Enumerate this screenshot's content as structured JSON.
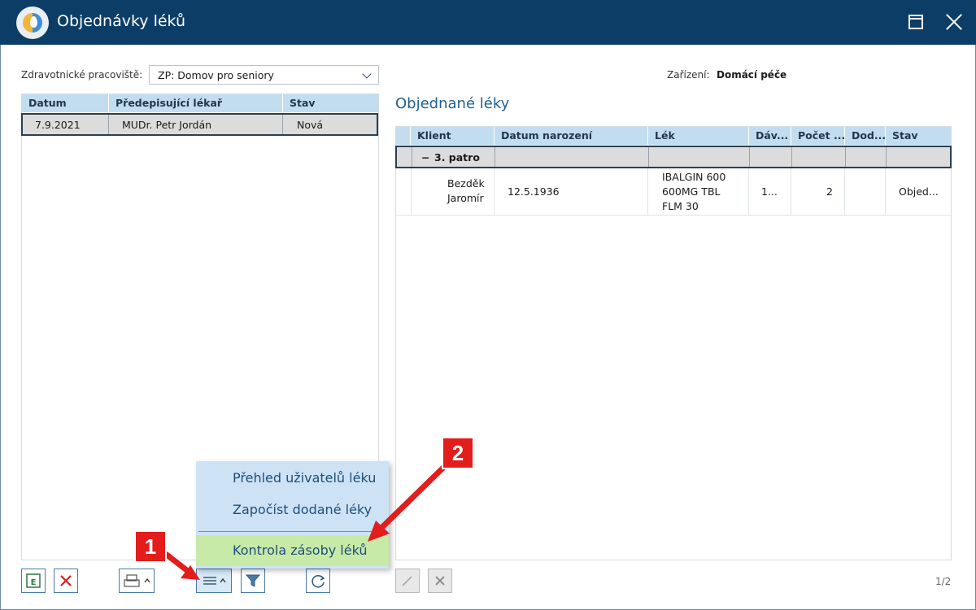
{
  "window": {
    "title": "Objednávky léků"
  },
  "filters": {
    "workplace_label": "Zdravotnické pracoviště:",
    "workplace_value": "ZP: Domov pro seniory",
    "device_label": "Zařízení:",
    "device_value": "Domácí péče"
  },
  "orders_table": {
    "columns": [
      "Datum",
      "Předepisující lékař",
      "Stav"
    ],
    "rows": [
      {
        "date": "7.9.2021",
        "doctor": "MUDr. Petr Jordán",
        "status": "Nová"
      }
    ]
  },
  "ordered_drugs": {
    "heading": "Objednané léky",
    "columns": [
      "Klient",
      "Datum narození",
      "Lék",
      "Dáv...",
      "Počet ...",
      "Dod...",
      "Stav"
    ],
    "group": {
      "toggle": "−",
      "label": "3. patro"
    },
    "rows": [
      {
        "client_line1": "Bezděk",
        "client_line2": "Jaromír",
        "birth_date": "12.5.1936",
        "drug_line1": "IBALGIN 600",
        "drug_line2": "600MG TBL",
        "drug_line3": "FLM 30",
        "dose": "1...",
        "count": "2",
        "delivered": "",
        "status": "Objed..."
      }
    ]
  },
  "context_menu": {
    "items": [
      "Přehled uživatelů léku",
      "Započíst dodané léky",
      "Kontrola zásoby léků"
    ],
    "highlighted_index": 2
  },
  "annotations": {
    "badge1": "1",
    "badge2": "2",
    "arrow_color": "#e31c1c"
  },
  "pager": {
    "text": "1/2"
  },
  "colors": {
    "titlebar": "#0c3d66",
    "header": "#c3ddf0",
    "menu": "#cde3f5",
    "menu_highlight": "#c8eaa8",
    "accent": "#1f5f93"
  },
  "icons": [
    "app-logo-icon",
    "maximize-icon",
    "close-icon",
    "excel-icon",
    "delete-icon",
    "print-icon",
    "menu-icon",
    "filter-icon",
    "refresh-icon",
    "edit-icon",
    "cancel-icon"
  ]
}
